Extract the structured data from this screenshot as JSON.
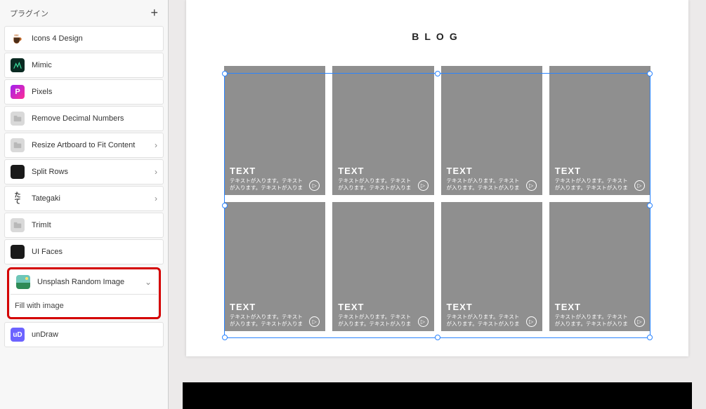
{
  "sidebar": {
    "title": "プラグイン",
    "add_label": "+",
    "items": [
      {
        "name": "Icons 4 Design",
        "icon": "coffee",
        "chev": ""
      },
      {
        "name": "Mimic",
        "icon": "mimic",
        "chev": ""
      },
      {
        "name": "Pixels",
        "icon": "pixels",
        "chev": ""
      },
      {
        "name": "Remove Decimal Numbers",
        "icon": "gray",
        "chev": ""
      },
      {
        "name": "Resize Artboard to Fit Content",
        "icon": "gray",
        "chev": "›"
      },
      {
        "name": "Split Rows",
        "icon": "split",
        "chev": "›"
      },
      {
        "name": "Tategaki",
        "icon": "tategaki",
        "chev": "›"
      },
      {
        "name": "TrimIt",
        "icon": "gray",
        "chev": ""
      },
      {
        "name": "UI Faces",
        "icon": "uifaces",
        "chev": ""
      }
    ],
    "highlighted": {
      "name": "Unsplash Random Image",
      "icon": "unsplash",
      "chev": "⌄",
      "subitem": "Fill with image"
    },
    "after": [
      {
        "name": "unDraw",
        "icon": "undraw",
        "chev": ""
      }
    ]
  },
  "canvas": {
    "page_title": "BLOG",
    "card": {
      "title": "TEXT",
      "body": "テキストが入ります。テキストが入ります。テキストが入りま",
      "arrow": "▷"
    },
    "card_count": 8
  },
  "colors": {
    "selection": "#2a84ff",
    "highlight": "#d40000",
    "card_bg": "#8f8f8f"
  }
}
